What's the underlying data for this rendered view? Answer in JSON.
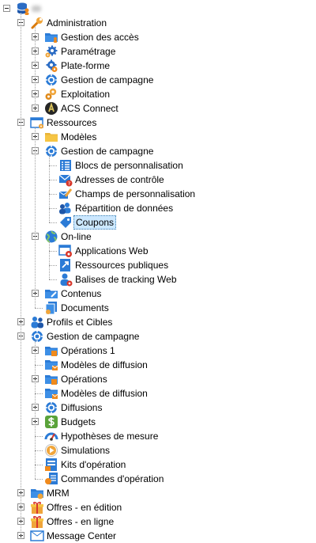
{
  "tree": {
    "root": {
      "label": "",
      "icon": "database-user-icon"
    },
    "nodes": [
      {
        "label": "Administration",
        "icon": "wrench-icon",
        "level": 1,
        "expander": "minus"
      },
      {
        "label": "Gestion des accès",
        "icon": "folder-user-icon",
        "level": 2,
        "expander": "plus"
      },
      {
        "label": "Paramétrage",
        "icon": "gear-settings-icon",
        "level": 2,
        "expander": "plus"
      },
      {
        "label": "Plate-forme",
        "icon": "gear-orange-icon",
        "level": 2,
        "expander": "plus"
      },
      {
        "label": "Gestion de campagne",
        "icon": "campaign-wheel-icon",
        "level": 2,
        "expander": "plus"
      },
      {
        "label": "Exploitation",
        "icon": "gears-orange-icon",
        "level": 2,
        "expander": "plus"
      },
      {
        "label": "ACS Connect",
        "icon": "acs-connect-icon",
        "level": 2,
        "expander": "plus"
      },
      {
        "label": "Ressources",
        "icon": "resources-folder-icon",
        "level": 1,
        "expander": "minus"
      },
      {
        "label": "Modèles",
        "icon": "yellow-folder-icon",
        "level": 2,
        "expander": "plus"
      },
      {
        "label": "Gestion de campagne",
        "icon": "campaign-wheel-icon",
        "level": 2,
        "expander": "minus"
      },
      {
        "label": "Blocs de personnalisation",
        "icon": "blocks-list-icon",
        "level": 3,
        "expander": null
      },
      {
        "label": "Adresses de contrôle",
        "icon": "envelope-question-icon",
        "level": 3,
        "expander": null
      },
      {
        "label": "Champs de personnalisation",
        "icon": "pen-edit-icon",
        "level": 3,
        "expander": null
      },
      {
        "label": "Répartition de données",
        "icon": "users-split-icon",
        "level": 3,
        "expander": null
      },
      {
        "label": "Coupons",
        "icon": "coupon-tag-icon",
        "level": 3,
        "expander": null,
        "selected": true
      },
      {
        "label": "On-line",
        "icon": "globe-icon",
        "level": 2,
        "expander": "minus"
      },
      {
        "label": "Applications Web",
        "icon": "web-app-icon",
        "level": 3,
        "expander": null
      },
      {
        "label": "Ressources publiques",
        "icon": "public-resource-icon",
        "level": 3,
        "expander": null
      },
      {
        "label": "Balises de tracking Web",
        "icon": "tracking-user-icon",
        "level": 3,
        "expander": null
      },
      {
        "label": "Contenus",
        "icon": "content-folder-icon",
        "level": 2,
        "expander": "plus"
      },
      {
        "label": "Documents",
        "icon": "documents-icon",
        "level": 2,
        "expander": null
      },
      {
        "label": "Profils et Cibles",
        "icon": "profiles-users-icon",
        "level": 1,
        "expander": "plus"
      },
      {
        "label": "Gestion de campagne",
        "icon": "campaign-wheel-icon",
        "level": 1,
        "expander": "minus"
      },
      {
        "label": "Opérations 1",
        "icon": "operations-folder-icon",
        "level": 2,
        "expander": "plus"
      },
      {
        "label": "Modèles de diffusion",
        "icon": "delivery-template-icon",
        "level": 2,
        "expander": null
      },
      {
        "label": "Opérations",
        "icon": "operations-folder-icon",
        "level": 2,
        "expander": "plus"
      },
      {
        "label": "Modèles de diffusion",
        "icon": "delivery-template-icon",
        "level": 2,
        "expander": null
      },
      {
        "label": "Diffusions",
        "icon": "campaign-wheel-icon",
        "level": 2,
        "expander": "plus"
      },
      {
        "label": "Budgets",
        "icon": "budget-icon",
        "level": 2,
        "expander": "plus"
      },
      {
        "label": "Hypothèses de mesure",
        "icon": "measure-gauge-icon",
        "level": 2,
        "expander": null
      },
      {
        "label": "Simulations",
        "icon": "simulation-play-icon",
        "level": 2,
        "expander": null
      },
      {
        "label": "Kits d'opération",
        "icon": "operation-kit-icon",
        "level": 2,
        "expander": null
      },
      {
        "label": "Commandes d'opération",
        "icon": "operation-order-icon",
        "level": 2,
        "expander": null
      },
      {
        "label": "MRM",
        "icon": "mrm-folder-icon",
        "level": 1,
        "expander": "plus"
      },
      {
        "label": "Offres - en édition",
        "icon": "offers-gift-icon",
        "level": 1,
        "expander": "plus"
      },
      {
        "label": "Offres - en ligne",
        "icon": "offers-gift-icon",
        "level": 1,
        "expander": "plus"
      },
      {
        "label": "Message Center",
        "icon": "message-center-icon",
        "level": 1,
        "expander": "plus"
      }
    ]
  }
}
